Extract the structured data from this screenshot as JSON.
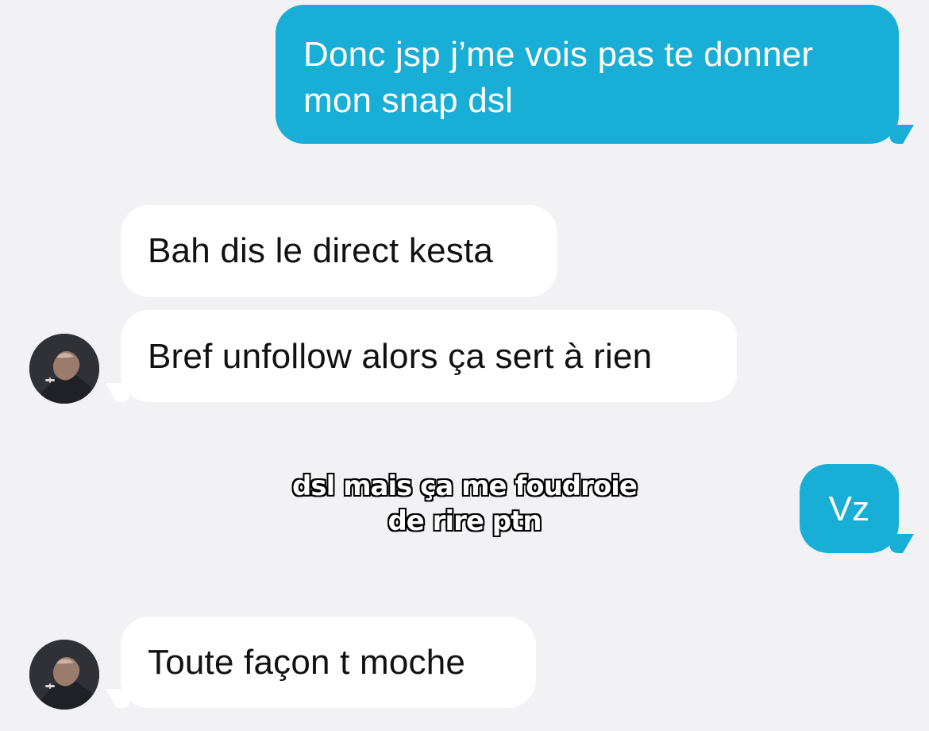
{
  "colors": {
    "background": "#f2f2f5",
    "sent_bubble": "#19aed6",
    "received_bubble": "#ffffff",
    "received_text": "#111111",
    "sent_text": "#ffffff"
  },
  "messages": [
    {
      "direction": "sent",
      "text": "Donc jsp j’me vois pas te donner\nmon snap dsl"
    },
    {
      "direction": "received",
      "text": "Bah dis le direct kesta"
    },
    {
      "direction": "received",
      "text": "Bref unfollow alors ça sert à rien",
      "avatar": "contact-avatar"
    },
    {
      "direction": "sent",
      "text": "Vz"
    },
    {
      "direction": "received",
      "text": "Toute façon t moche",
      "avatar": "contact-avatar"
    }
  ],
  "overlay_caption": {
    "line1": "dsl mais ça me foudroie",
    "line2": "de rire ptn"
  }
}
